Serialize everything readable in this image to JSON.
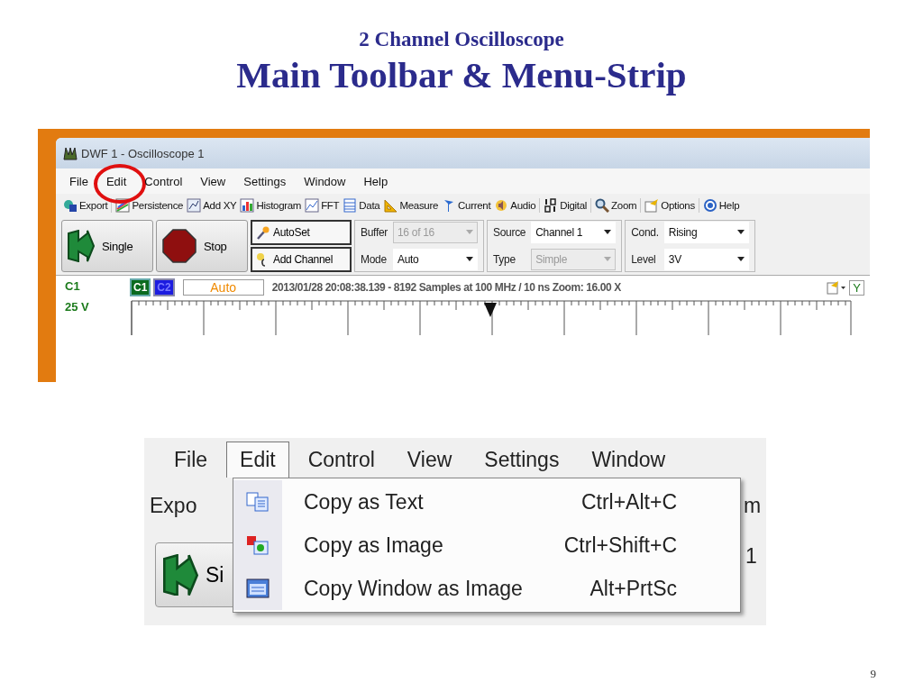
{
  "slide": {
    "subtitle": "2 Channel Oscilloscope",
    "title": "Main Toolbar & Menu-Strip",
    "page_number": "9"
  },
  "screenshot": {
    "window_title": "DWF 1 - Oscilloscope 1",
    "menu": [
      {
        "label": "File",
        "circled": false
      },
      {
        "label": "Edit",
        "circled": true
      },
      {
        "label": "Control",
        "circled": false
      },
      {
        "label": "View",
        "circled": false
      },
      {
        "label": "Settings",
        "circled": false
      },
      {
        "label": "Window",
        "circled": false
      },
      {
        "label": "Help",
        "circled": false
      }
    ],
    "toolbar": [
      [
        {
          "label": "Export"
        }
      ],
      [
        {
          "label": "Persistence"
        },
        {
          "label": "Add XY"
        },
        {
          "label": "Histogram"
        },
        {
          "label": "FFT"
        },
        {
          "label": "Data"
        },
        {
          "label": "Measure"
        },
        {
          "label": "Current"
        },
        {
          "label": "Audio"
        }
      ],
      [
        {
          "label": "Digital"
        }
      ],
      [
        {
          "label": "Zoom"
        }
      ],
      [
        {
          "label": "Options"
        }
      ],
      [
        {
          "label": "Help"
        }
      ]
    ],
    "run_buttons": [
      {
        "label": "Single"
      },
      {
        "label": "Stop"
      }
    ],
    "actions": [
      {
        "label": "AutoSet"
      },
      {
        "label": "Add Channel"
      }
    ],
    "field_columns": [
      [
        {
          "label": "Buffer",
          "value": "16 of 16",
          "disabled": true
        },
        {
          "label": "Mode",
          "value": "Auto",
          "disabled": false
        }
      ],
      [
        {
          "label": "Source",
          "value": "Channel 1",
          "disabled": false
        },
        {
          "label": "Type",
          "value": "Simple",
          "disabled": true
        }
      ],
      [
        {
          "label": "Cond.",
          "value": "Rising",
          "disabled": false
        },
        {
          "label": "Level",
          "value": "3V",
          "disabled": false
        }
      ]
    ],
    "scope": {
      "channel": "C1",
      "scale": "25 V",
      "channels": [
        {
          "label": "C1",
          "color": "#0b6b1f",
          "selected": true
        },
        {
          "label": "C2",
          "color": "#1c1ce0",
          "selected": false
        }
      ],
      "mode": "Auto",
      "info": "2013/01/28 20:08:38.139 - 8192 Samples at 100 MHz / 10 ns Zoom: 16.00 X",
      "axis": "Y"
    }
  },
  "closeup": {
    "menu": [
      {
        "label": "File",
        "selected": false
      },
      {
        "label": "Edit",
        "selected": true
      },
      {
        "label": "Control",
        "selected": false
      },
      {
        "label": "View",
        "selected": false
      },
      {
        "label": "Settings",
        "selected": false
      },
      {
        "label": "Window",
        "selected": false
      }
    ],
    "toolbar_fragment": "Expo",
    "right_fragment": "m",
    "button_fragment": "Si",
    "right_button_fragment": "1",
    "dropdown": [
      {
        "label": "Copy as Text",
        "shortcut": "Ctrl+Alt+C"
      },
      {
        "label": "Copy as Image",
        "shortcut": "Ctrl+Shift+C"
      },
      {
        "label": "Copy Window as Image",
        "shortcut": "Alt+PrtSc"
      }
    ]
  }
}
